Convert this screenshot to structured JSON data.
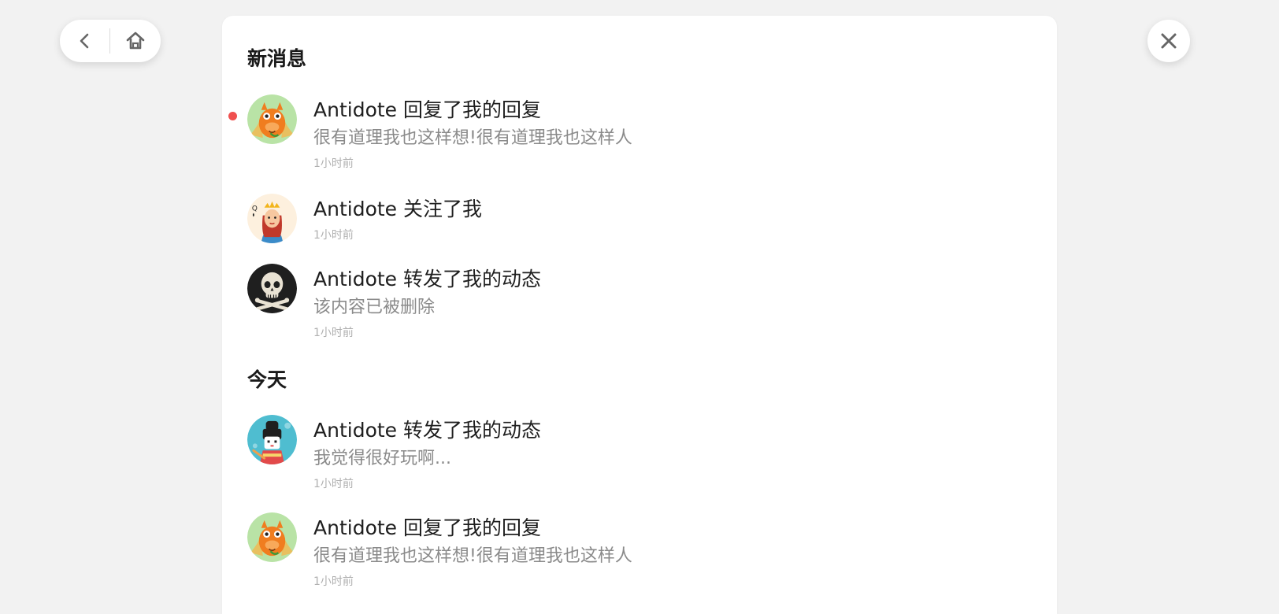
{
  "sections": [
    {
      "title": "新消息"
    },
    {
      "title": "今天"
    }
  ],
  "notifications": [
    {
      "title": "Antidote 回复了我的回复",
      "content": "很有道理我也这样想!很有道理我也这样人",
      "time": "1小时前",
      "unread": true,
      "avatar_icon": "dragon-avatar-icon"
    },
    {
      "title": "Antidote 关注了我",
      "content": "",
      "time": "1小时前",
      "unread": false,
      "avatar_icon": "queen-card-avatar-icon"
    },
    {
      "title": "Antidote 转发了我的动态",
      "content": "该内容已被删除",
      "time": "1小时前",
      "unread": false,
      "avatar_icon": "skull-avatar-icon"
    },
    {
      "title": "Antidote 转发了我的动态",
      "content": "我觉得很好玩啊...",
      "time": "1小时前",
      "unread": false,
      "avatar_icon": "geisha-avatar-icon"
    },
    {
      "title": "Antidote 回复了我的回复",
      "content": "很有道理我也这样想!很有道理我也这样人",
      "time": "1小时前",
      "unread": false,
      "avatar_icon": "dragon-avatar-icon"
    }
  ],
  "colors": {
    "unread_dot": "#f0504f",
    "background": "#f2f2f2",
    "panel": "#ffffff"
  }
}
